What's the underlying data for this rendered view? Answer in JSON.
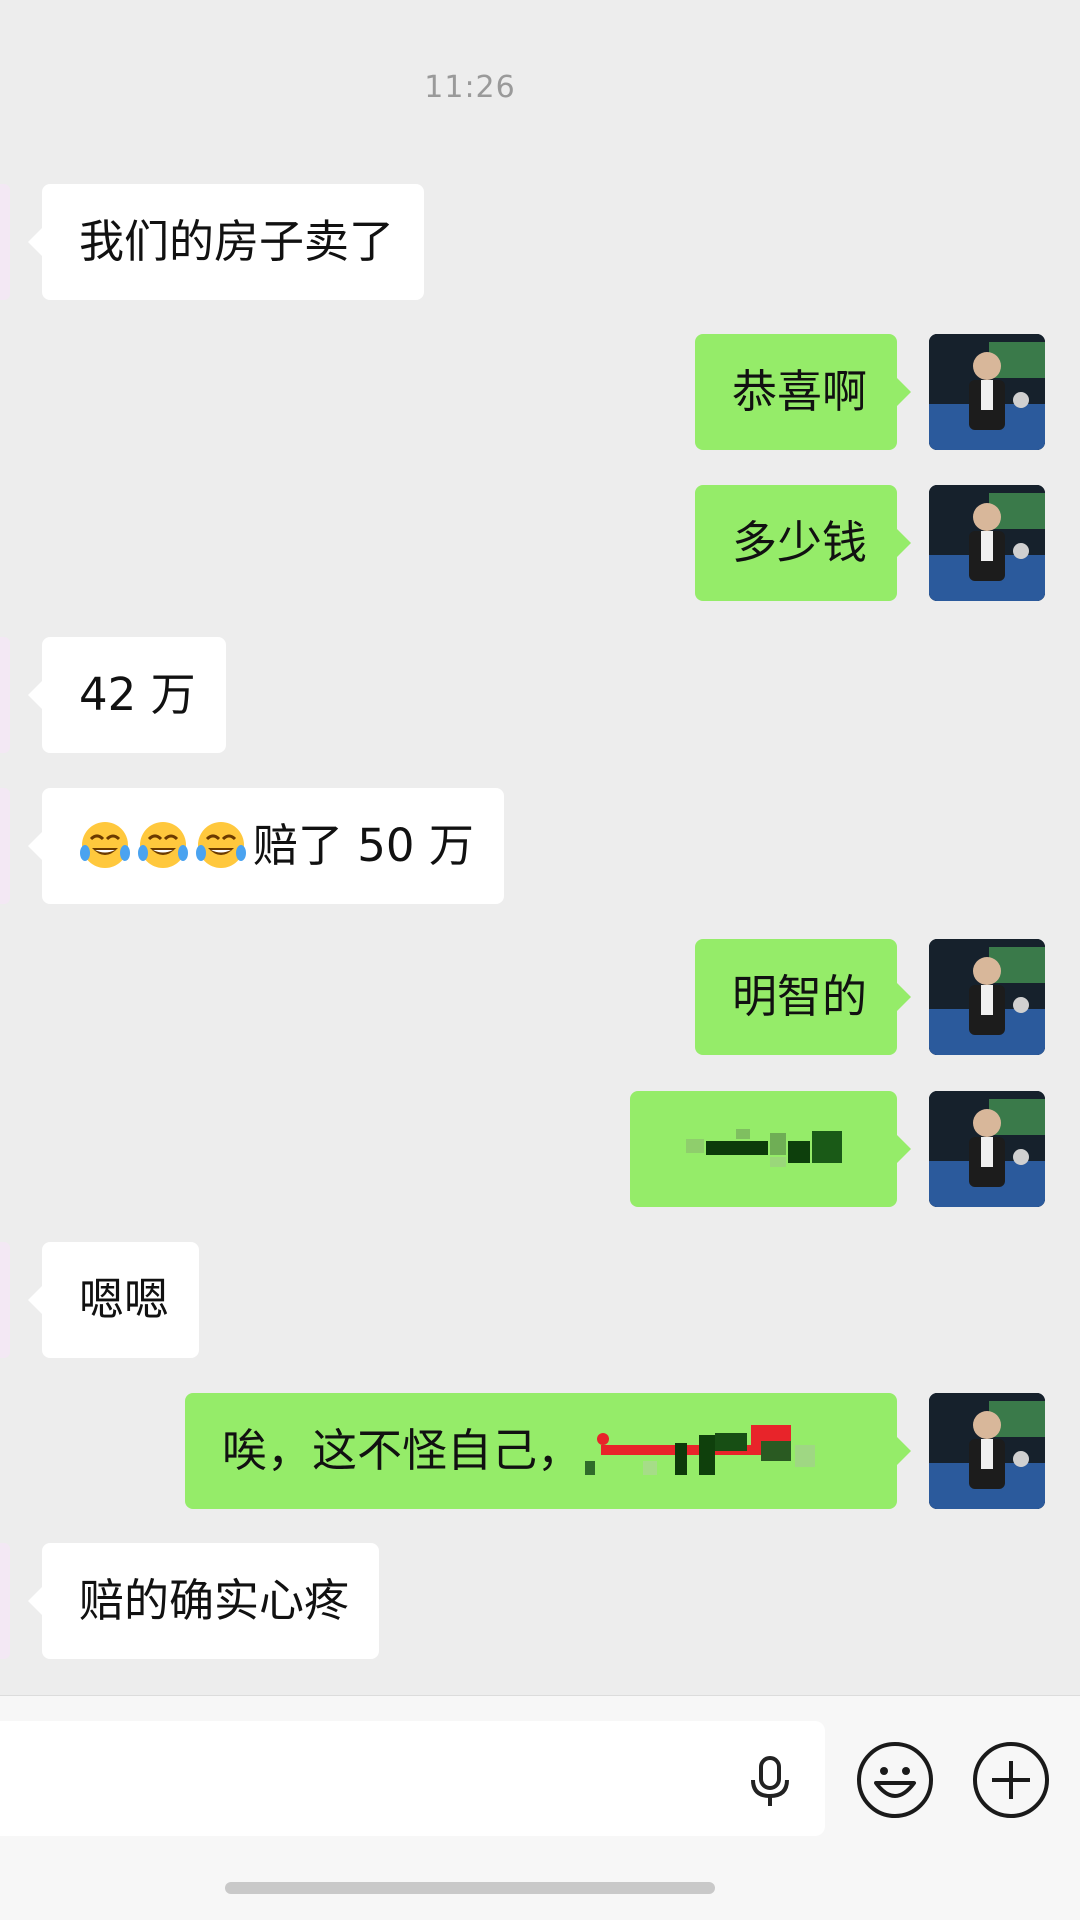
{
  "chat": {
    "timestamp": "11:26",
    "messages": [
      {
        "side": "left",
        "text": "我们的房子卖了"
      },
      {
        "side": "right",
        "text": "恭喜啊"
      },
      {
        "side": "right",
        "text": "多少钱"
      },
      {
        "side": "left",
        "text": "42 万"
      },
      {
        "side": "left",
        "emoji_prefix": [
          "tears-of-joy-emoji",
          "tears-of-joy-emoji",
          "tears-of-joy-emoji"
        ],
        "text": "赔了 50 万"
      },
      {
        "side": "right",
        "text": "明智的"
      },
      {
        "side": "right",
        "text": "",
        "note_redacted": true
      },
      {
        "side": "left",
        "text": "嗯嗯"
      },
      {
        "side": "right",
        "text": "唉，这不怪自己，",
        "redacted_suffix": true
      },
      {
        "side": "left",
        "text": "赔的确实心疼"
      }
    ]
  },
  "input_bar": {
    "placeholder": "",
    "icons": [
      "microphone-icon",
      "emoji-face-icon",
      "plus-icon"
    ]
  },
  "colors": {
    "background": "#ededed",
    "incoming_bubble": "#ffffff",
    "outgoing_bubble": "#95ec69",
    "timestamp": "#9a9a9a"
  }
}
